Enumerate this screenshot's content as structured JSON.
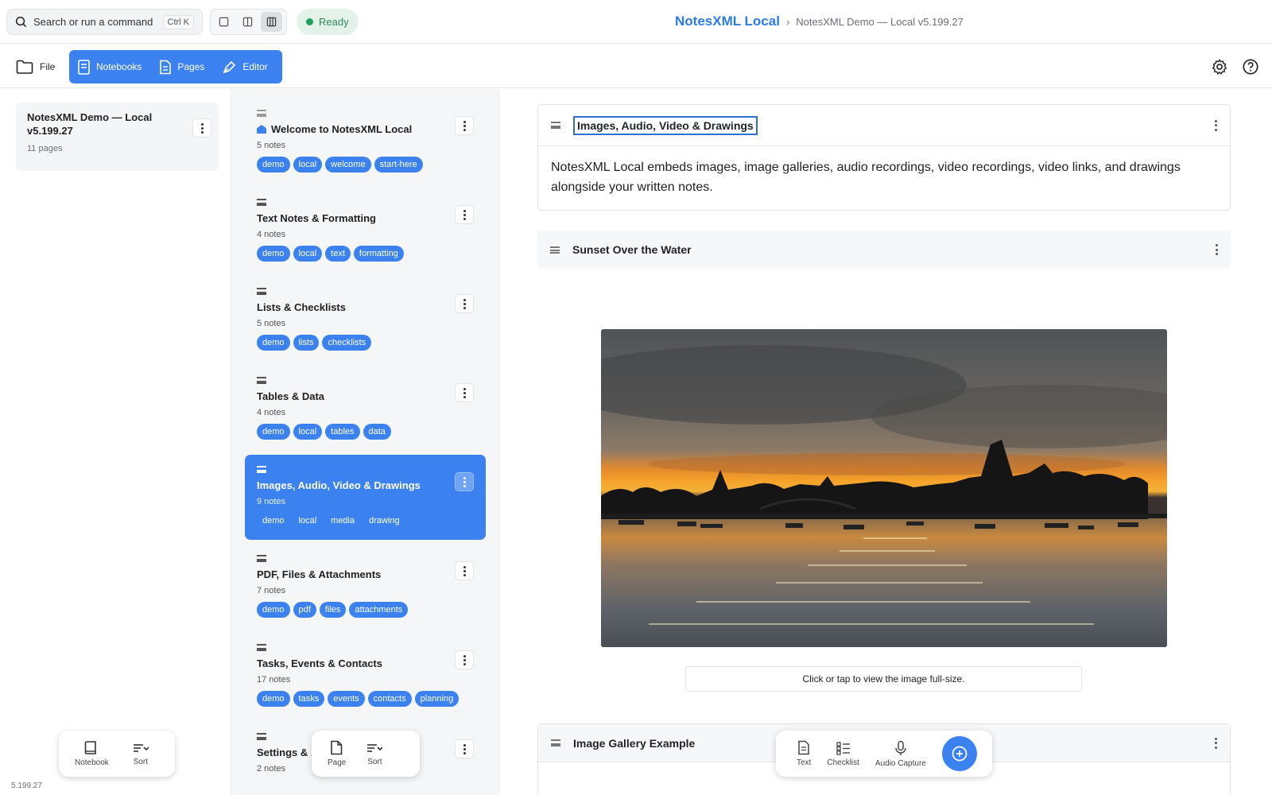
{
  "header": {
    "search_label": "Search or run a command",
    "search_shortcut": "Ctrl K",
    "status": "Ready",
    "app_name": "NotesXML Local",
    "breadcrumb_sep": "›",
    "notebook_crumb": "NotesXML Demo — Local v5.199.27"
  },
  "toolbar": {
    "file": "File",
    "notebooks": "Notebooks",
    "pages": "Pages",
    "editor": "Editor"
  },
  "notebooks": {
    "card": {
      "title": "NotesXML Demo — Local v5.199.27",
      "subtitle": "11 pages"
    },
    "bottom": {
      "notebook": "Notebook",
      "sort": "Sort"
    },
    "version": "5.199.27"
  },
  "pages": {
    "items": [
      {
        "title": "Welcome to NotesXML Local",
        "subtitle": "5 notes",
        "tags": [
          "demo",
          "local",
          "welcome",
          "start-here"
        ]
      },
      {
        "title": "Text Notes & Formatting",
        "subtitle": "4 notes",
        "tags": [
          "demo",
          "local",
          "text",
          "formatting"
        ]
      },
      {
        "title": "Lists & Checklists",
        "subtitle": "5 notes",
        "tags": [
          "demo",
          "lists",
          "checklists"
        ]
      },
      {
        "title": "Tables & Data",
        "subtitle": "4 notes",
        "tags": [
          "demo",
          "local",
          "tables",
          "data"
        ]
      },
      {
        "title": "Images, Audio, Video & Drawings",
        "subtitle": "9 notes",
        "tags": [
          "demo",
          "local",
          "media",
          "drawing"
        ]
      },
      {
        "title": "PDF, Files & Attachments",
        "subtitle": "7 notes",
        "tags": [
          "demo",
          "pdf",
          "files",
          "attachments"
        ]
      },
      {
        "title": "Tasks, Events & Contacts",
        "subtitle": "17 notes",
        "tags": [
          "demo",
          "tasks",
          "events",
          "contacts",
          "planning"
        ]
      },
      {
        "title": "Settings & ...",
        "subtitle": "2 notes",
        "tags": []
      }
    ],
    "bottom": {
      "page": "Page",
      "sort": "Sort"
    }
  },
  "editor": {
    "page_title": "Images, Audio, Video & Drawings",
    "intro": "NotesXML Local embeds images, image galleries, audio recordings, video recordings, video links, and drawings alongside your written notes.",
    "image_note_title": "Sunset Over the Water",
    "image_caption": "Click or tap to view the image full-size.",
    "gallery_title": "Image Gallery Example",
    "add_bar": {
      "text": "Text",
      "checklist": "Checklist",
      "audio": "Audio Capture"
    }
  },
  "colors": {
    "accent": "#3b82f0",
    "ready_bg": "#e3f3ea",
    "ready_dot": "#22a05a"
  }
}
